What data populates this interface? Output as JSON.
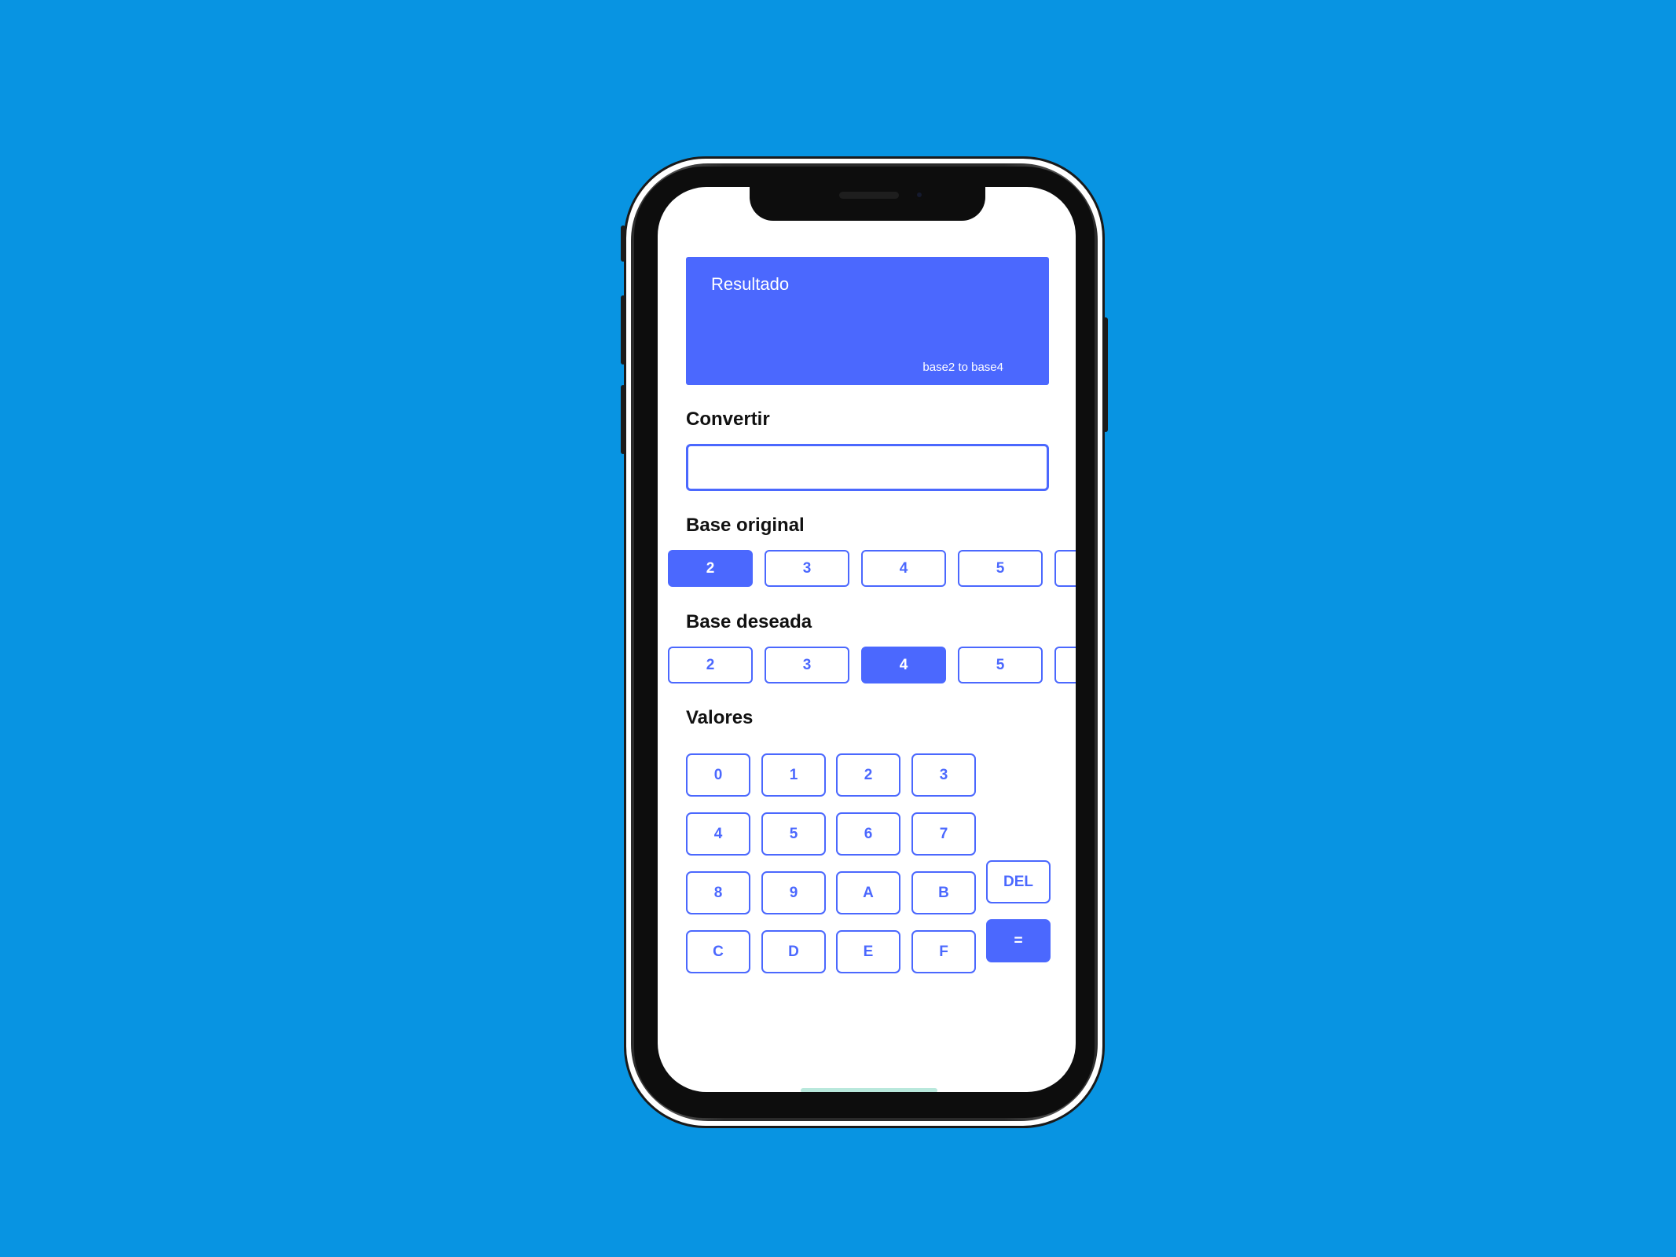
{
  "result": {
    "title": "Resultado",
    "conversion": "base2 to base4"
  },
  "convert": {
    "label": "Convertir",
    "value": "",
    "placeholder": ""
  },
  "base_original": {
    "label": "Base original",
    "options": [
      "2",
      "3",
      "4",
      "5"
    ],
    "selected": "2"
  },
  "base_deseada": {
    "label": "Base deseada",
    "options": [
      "2",
      "3",
      "4",
      "5"
    ],
    "selected": "4"
  },
  "valores": {
    "label": "Valores",
    "keys": [
      "0",
      "1",
      "2",
      "3",
      "4",
      "5",
      "6",
      "7",
      "8",
      "9",
      "A",
      "B",
      "C",
      "D",
      "E",
      "F"
    ],
    "delete_label": "DEL",
    "equals_label": "="
  },
  "colors": {
    "background": "#0894E2",
    "accent": "#4B68FE",
    "screen": "#FFFFFF"
  }
}
